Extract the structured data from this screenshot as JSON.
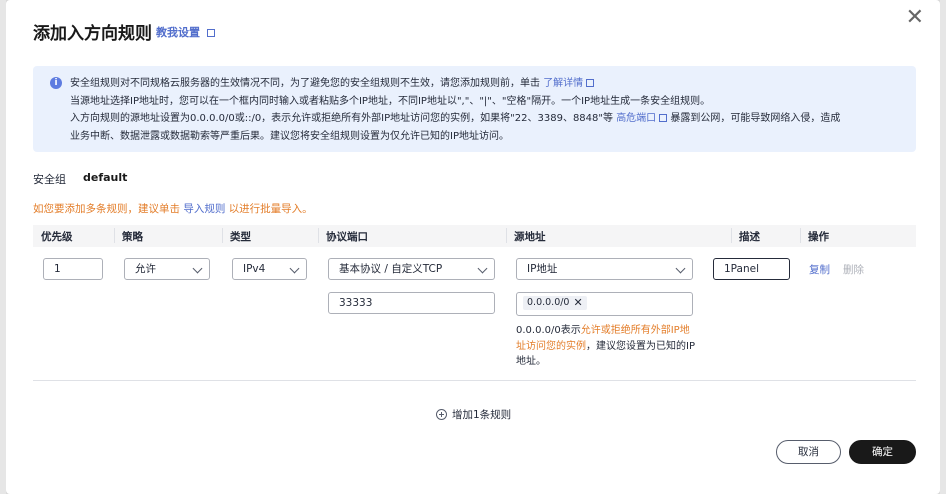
{
  "dialog": {
    "title": "添加入方向规则",
    "help_link": "教我设置",
    "close_label": "✕"
  },
  "notice": {
    "line1": "安全组规则对不同规格云服务器的生效情况不同，为了避免您的安全组规则不生效，请您添加规则前，单击",
    "line1_link": "了解详情",
    "line2": "当源地址选择IP地址时，您可以在一个框内同时输入或者粘贴多个IP地址，不同IP地址以\",\"、\"|\"、\"空格\"隔开。一个IP地址生成一条安全组规则。",
    "line3a": "入方向规则的源地址设置为0.0.0.0/0或::/0，表示允许或拒绝所有外部IP地址访问您的实例，如果将\"22、3389、8848\"等",
    "line3_link": "高危端口",
    "line3b": "暴露到公网，可能导致网络入侵，造成",
    "line4": "业务中断、数据泄露或数据勒索等严重后果。建议您将安全组规则设置为仅允许已知的IP地址访问。"
  },
  "security_group": {
    "label": "安全组",
    "value": "default"
  },
  "hint": {
    "before": "如您要添加多条规则，建议单击",
    "link": "导入规则",
    "after": "以进行批量导入。"
  },
  "table": {
    "headers": [
      "优先级",
      "策略",
      "类型",
      "协议端口",
      "源地址",
      "描述",
      "操作"
    ],
    "row": {
      "priority": "1",
      "policy": "允许",
      "type": "IPv4",
      "protocol": "基本协议 / 自定义TCP",
      "port": "33333",
      "source_type": "IP地址",
      "source_tag": "0.0.0.0/0",
      "description": "1Panel",
      "copy": "复制",
      "delete": "删除"
    }
  },
  "source_note": {
    "a": "0.0.0.0/0表示",
    "hl": "允许或拒绝所有外部IP地址访问您的实例",
    "b": "，建议您设置为已知的IP地址。"
  },
  "add_rule": "增加1条规则",
  "buttons": {
    "cancel": "取消",
    "ok": "确定"
  }
}
